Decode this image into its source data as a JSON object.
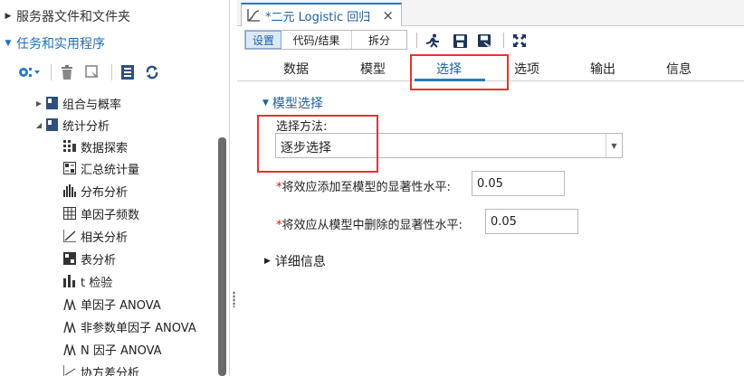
{
  "navigator": {
    "servers_label": "服务器文件和文件夹",
    "tasks_label": "任务和实用程序",
    "tree": [
      {
        "label": "组合与概率",
        "icon": "book-icon"
      },
      {
        "label": "统计分析",
        "icon": "book-icon"
      },
      {
        "label": "数据探索",
        "icon": "data-explore-icon"
      },
      {
        "label": "汇总统计量",
        "icon": "summary-icon"
      },
      {
        "label": "分布分析",
        "icon": "distribution-icon"
      },
      {
        "label": "单因子频数",
        "icon": "table-icon"
      },
      {
        "label": "相关分析",
        "icon": "correlation-icon"
      },
      {
        "label": "表分析",
        "icon": "table-analysis-icon"
      },
      {
        "label": "t 检验",
        "icon": "ttest-icon"
      },
      {
        "label": "单因子 ANOVA",
        "icon": "anova-icon"
      },
      {
        "label": "非参数单因子 ANOVA",
        "icon": "anova-icon"
      },
      {
        "label": "N 因子 ANOVA",
        "icon": "anova-icon"
      },
      {
        "label": "协方差分析",
        "icon": "covariance-icon"
      }
    ]
  },
  "window": {
    "tab_title": "*二元 Logistic 回归",
    "toolbar": {
      "setup_label": "设置",
      "code_results_label": "代码/结果",
      "split_label": "拆分"
    },
    "subtabs": [
      "数据",
      "模型",
      "选择",
      "选项",
      "输出",
      "信息"
    ],
    "selected_subtab": "选择",
    "model_selection": {
      "group_label": "模型选择",
      "method_label": "选择方法:",
      "method_value": "逐步选择",
      "add_label": "将效应添加至模型的显著性水平:",
      "add_value": "0.05",
      "remove_label": "将效应从模型中删除的显著性水平:",
      "remove_value": "0.05",
      "required_mark": "*"
    },
    "details_label": "详细信息"
  },
  "colors": {
    "accent": "#1f5fa0",
    "highlight_box": "#e53333"
  }
}
